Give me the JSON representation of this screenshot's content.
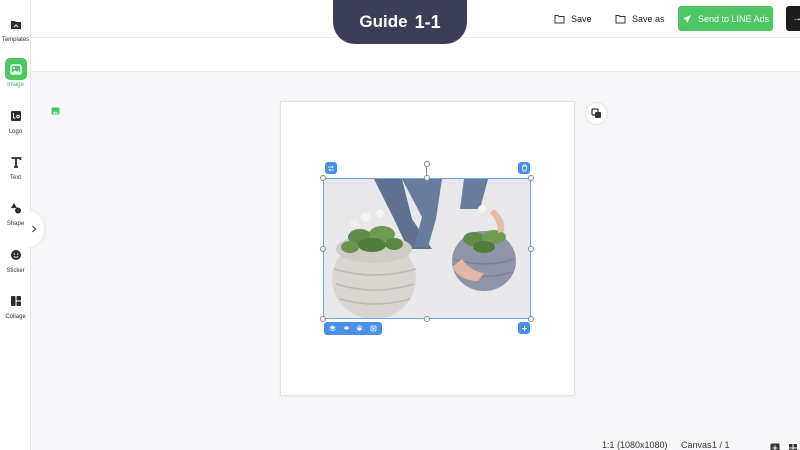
{
  "guide": {
    "word": "Guide",
    "number": "1-1"
  },
  "sidebar": {
    "items": [
      {
        "label": "Templates",
        "icon": "templates-icon",
        "active": false
      },
      {
        "label": "Image",
        "icon": "image-icon",
        "active": true
      },
      {
        "label": "Logo",
        "icon": "logo-icon",
        "active": false
      },
      {
        "label": "Text",
        "icon": "text-icon",
        "active": false
      },
      {
        "label": "Shape",
        "icon": "shape-icon",
        "active": false
      },
      {
        "label": "Sticker",
        "icon": "sticker-icon",
        "active": false
      },
      {
        "label": "Collage",
        "icon": "collage-icon",
        "active": false
      }
    ]
  },
  "toolbar": {
    "save_label": "Save",
    "save_as_label": "Save as",
    "send_label": "Send to LINE Ads"
  },
  "status": {
    "ratio": "1:1 (1080x1080)",
    "canvas_label": "Canvas",
    "page_count": "1 / 1"
  },
  "colors": {
    "accent": "#4cc764",
    "guide_bg": "#3b3e56",
    "selection": "#4a90e8"
  }
}
